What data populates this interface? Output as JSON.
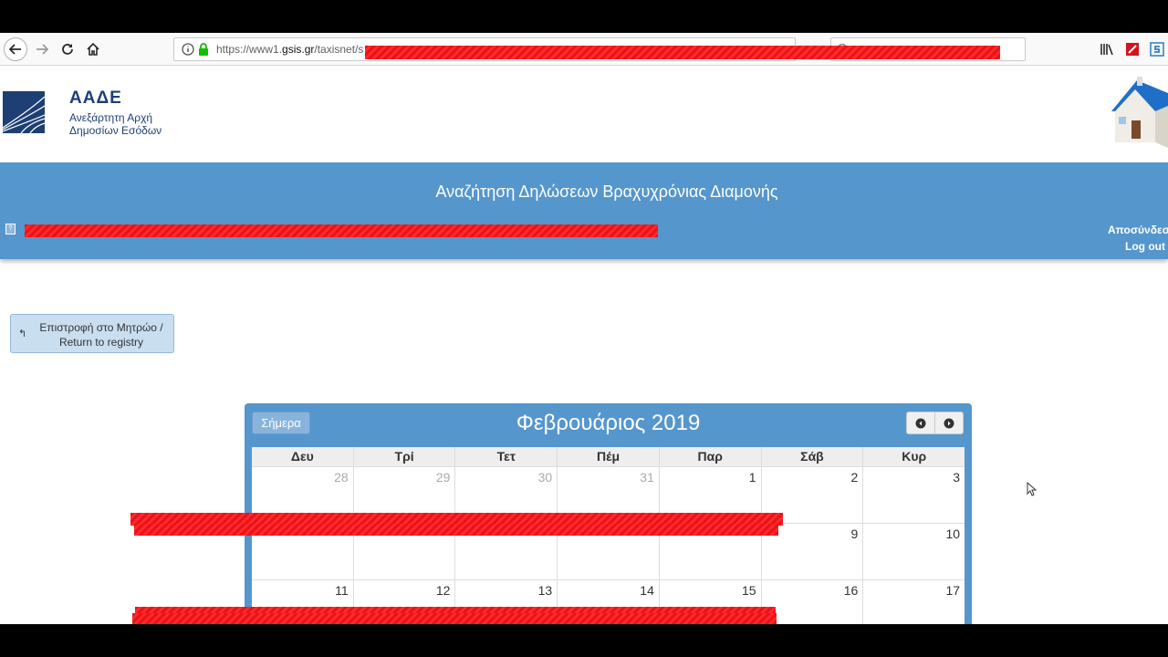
{
  "browser": {
    "url_prefix": "https://www1.",
    "url_domain": "gsis.gr",
    "url_path": "/taxisnet/s"
  },
  "header": {
    "logo_title": "ΑΑΔΕ",
    "logo_subtitle_line1": "Ανεξάρτητη Αρχή",
    "logo_subtitle_line2": "Δημοσίων Εσόδων"
  },
  "bluebar": {
    "title": "Αναζήτηση Δηλώσεων Βραχυχρόνιας Διαμονής",
    "logout_gr": "Αποσύνδεση",
    "logout_en": "Log out"
  },
  "return_button": {
    "line1": "Επιστροφή στο Μητρώο /",
    "line2": "Return to registry"
  },
  "calendar": {
    "today_label": "Σήμερα",
    "title": "Φεβρουάριος 2019",
    "days_of_week": [
      "Δευ",
      "Τρί",
      "Τετ",
      "Πέμ",
      "Παρ",
      "Σάβ",
      "Κυρ"
    ],
    "weeks": [
      [
        {
          "n": "28",
          "other": true
        },
        {
          "n": "29",
          "other": true
        },
        {
          "n": "30",
          "other": true
        },
        {
          "n": "31",
          "other": true
        },
        {
          "n": "1"
        },
        {
          "n": "2"
        },
        {
          "n": "3"
        }
      ],
      [
        {
          "n": ""
        },
        {
          "n": ""
        },
        {
          "n": ""
        },
        {
          "n": ""
        },
        {
          "n": ""
        },
        {
          "n": "9"
        },
        {
          "n": "10"
        }
      ],
      [
        {
          "n": "11"
        },
        {
          "n": "12"
        },
        {
          "n": "13"
        },
        {
          "n": "14"
        },
        {
          "n": "15"
        },
        {
          "n": "16"
        },
        {
          "n": "17"
        }
      ]
    ]
  },
  "colors": {
    "primary_blue": "#5596cd",
    "redaction": "#e8131a",
    "logo_navy": "#1d3f73"
  }
}
